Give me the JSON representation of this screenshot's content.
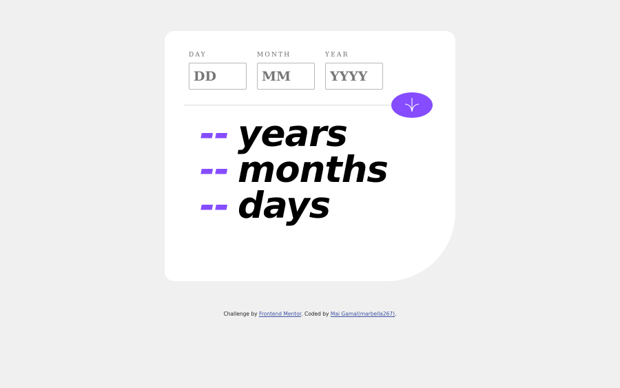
{
  "form": {
    "day": {
      "label": "DAY",
      "placeholder": "DD"
    },
    "month": {
      "label": "MONTH",
      "placeholder": "MM"
    },
    "year": {
      "label": "YEAR",
      "placeholder": "YYYY"
    },
    "submit_icon": "arrow-down-icon"
  },
  "results": [
    {
      "value": "--",
      "unit": "years"
    },
    {
      "value": "--",
      "unit": "months"
    },
    {
      "value": "--",
      "unit": "days"
    }
  ],
  "footer": {
    "prefix": "Challenge by ",
    "link1": "Frontend Mentor",
    "middle": ". Coded by ",
    "link2": "Mai Gamal(marbella267)",
    "suffix": "."
  },
  "colors": {
    "accent": "#854dff",
    "background": "#f0f0f0",
    "card": "#ffffff",
    "link": "#3e52a3"
  }
}
